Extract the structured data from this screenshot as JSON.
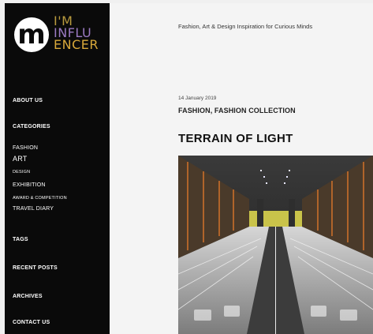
{
  "brand": {
    "logo_letter": "m",
    "logo_line1": "I'M",
    "logo_line2": "INFLU",
    "logo_line3": "ENCER"
  },
  "sidebar": {
    "about": "ABOUT US",
    "categories_label": "CATEGORIES",
    "categories": [
      "FASHION",
      "ART",
      "DESIGN",
      "EXHIBITION",
      "AWARD & COMPETITION",
      "TRAVEL DIARY"
    ],
    "tags": "TAGS",
    "recent_posts": "RECENT POSTS",
    "archives": "ARCHIVES",
    "contact": "CONTACT US"
  },
  "header": {
    "tagline": "Fashion, Art & Design Inspiration for Curious Minds"
  },
  "post": {
    "date": "14 January 2019",
    "categories": "FASHION, FASHION COLLECTION",
    "title": "TERRAIN OF LIGHT"
  },
  "colors": {
    "sidebar_bg": "#0a0a0a",
    "logo_gold": "#b89a3e",
    "logo_purple": "#9b7ac2",
    "logo_orange": "#d8a83a",
    "page_bg": "#f4f4f4"
  }
}
